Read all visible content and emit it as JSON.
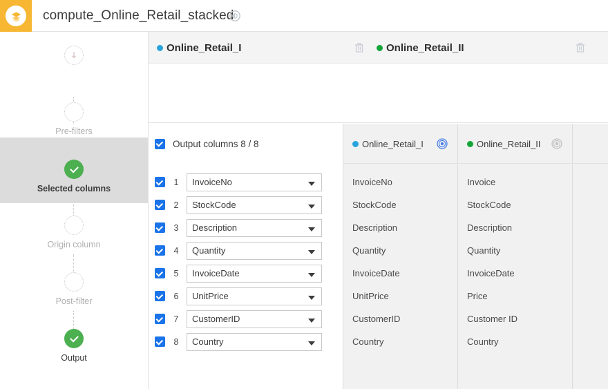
{
  "app": {
    "logo_icon": "layers-stack-icon",
    "title": "compute_Online_Retail_stacked",
    "title_badge_icon": "compass-view-icon",
    "accent_color": "#f7b733"
  },
  "rail": {
    "steps": [
      {
        "label": "",
        "icon": "download-arrow-icon",
        "state": "empty"
      },
      {
        "label": "Pre-filters",
        "icon": "empty-circle-icon",
        "state": "empty"
      },
      {
        "label": "Selected columns",
        "icon": "check-circle-icon",
        "state": "done-active"
      },
      {
        "label": "Origin column",
        "icon": "empty-circle-icon",
        "state": "empty"
      },
      {
        "label": "Post-filter",
        "icon": "empty-circle-icon",
        "state": "empty"
      },
      {
        "label": "Output",
        "icon": "check-circle-icon",
        "state": "done"
      }
    ]
  },
  "datasets": [
    {
      "name": "Online_Retail_I",
      "dot_color": "#29a3dc",
      "delete_icon": "trash-icon",
      "target_icon": "bullseye-icon",
      "target_active": true
    },
    {
      "name": "Online_Retail_II",
      "dot_color": "#13a538",
      "delete_icon": "trash-icon",
      "target_icon": "bullseye-icon",
      "target_active": false
    }
  ],
  "grid": {
    "output_columns_label": "Output columns 8 / 8",
    "output_columns_checked": true,
    "checkbox_color": "#1a73e8",
    "rows": [
      {
        "num": "1",
        "checked": true,
        "output": "InvoiceNo",
        "map1": "InvoiceNo",
        "map2": "Invoice"
      },
      {
        "num": "2",
        "checked": true,
        "output": "StockCode",
        "map1": "StockCode",
        "map2": "StockCode"
      },
      {
        "num": "3",
        "checked": true,
        "output": "Description",
        "map1": "Description",
        "map2": "Description"
      },
      {
        "num": "4",
        "checked": true,
        "output": "Quantity",
        "map1": "Quantity",
        "map2": "Quantity"
      },
      {
        "num": "5",
        "checked": true,
        "output": "InvoiceDate",
        "map1": "InvoiceDate",
        "map2": "InvoiceDate"
      },
      {
        "num": "6",
        "checked": true,
        "output": "UnitPrice",
        "map1": "UnitPrice",
        "map2": "Price"
      },
      {
        "num": "7",
        "checked": true,
        "output": "CustomerID",
        "map1": "CustomerID",
        "map2": "Customer ID"
      },
      {
        "num": "8",
        "checked": true,
        "output": "Country",
        "map1": "Country",
        "map2": "Country"
      }
    ]
  }
}
